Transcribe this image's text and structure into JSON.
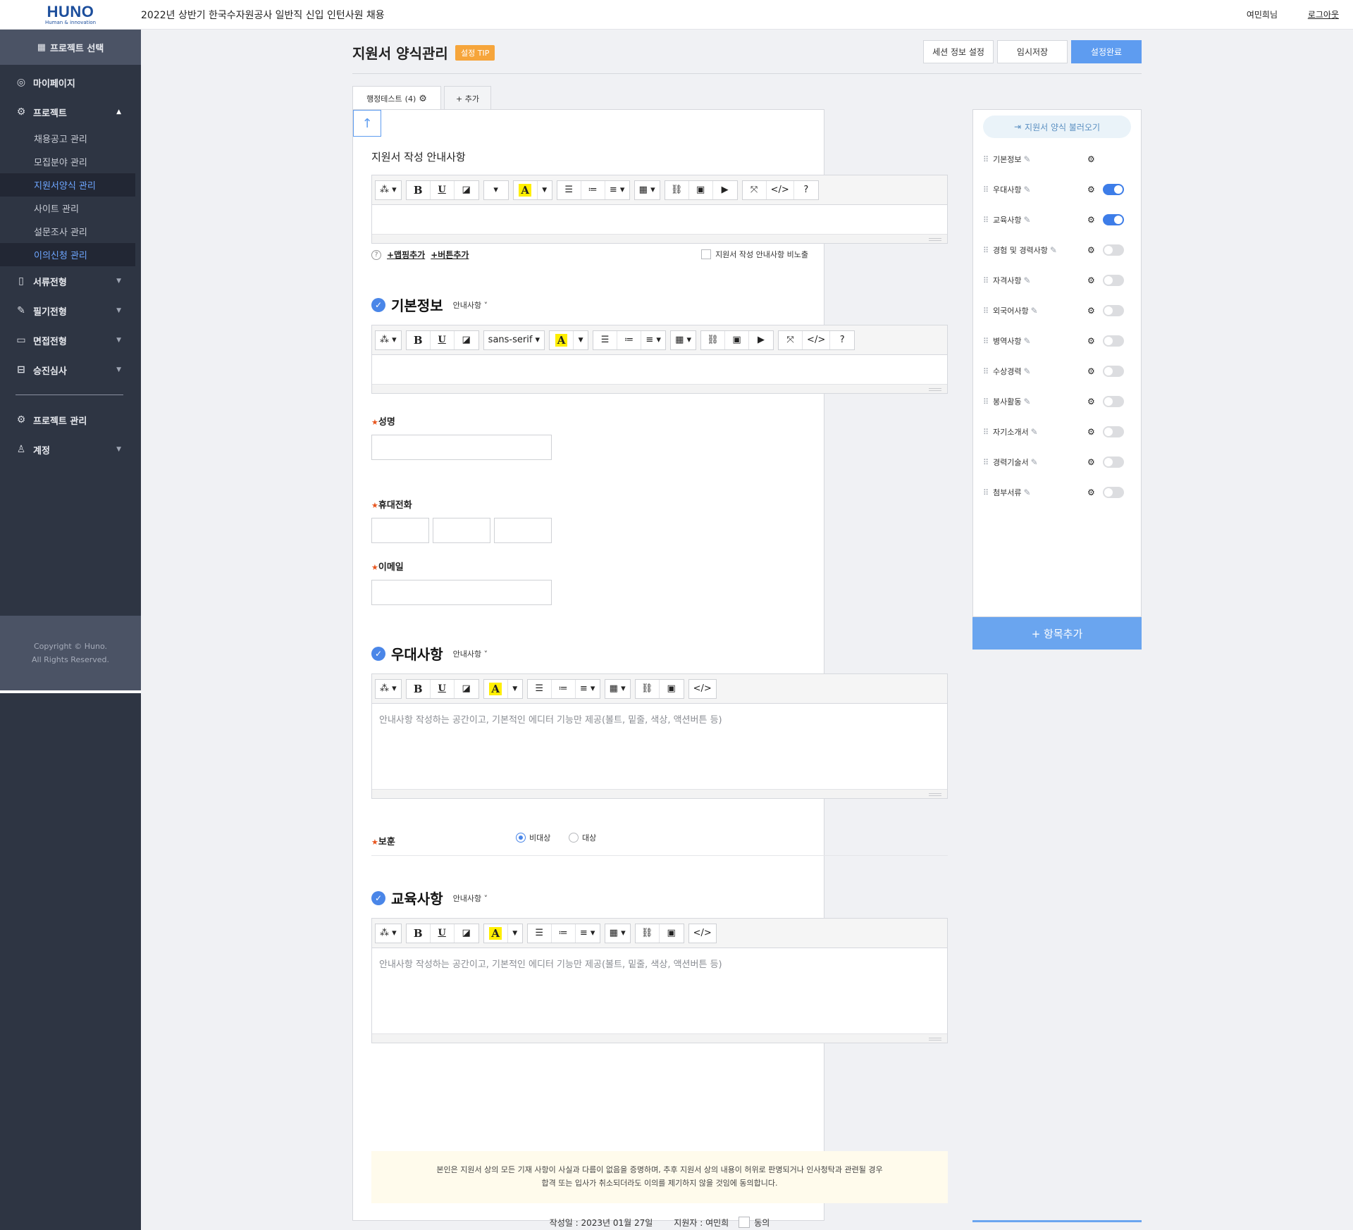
{
  "header": {
    "logo_main": "HUNO",
    "logo_sub": "Human & innovation",
    "project_title": "2022년 상반기 한국수자원공사 일반직 신입 인턴사원 채용",
    "user": "여민희님",
    "logout": "로그아웃"
  },
  "sidebar": {
    "project_select": "프로젝트 선택",
    "mypage": "마이페이지",
    "project": "프로젝트",
    "sub_items": [
      "채용공고 관리",
      "모집분야 관리",
      "지원서양식 관리",
      "사이트 관리",
      "설문조사 관리",
      "이의신청 관리"
    ],
    "stages": [
      "서류전형",
      "필기전형",
      "면접전형",
      "승진심사"
    ],
    "project_manage": "프로젝트 관리",
    "account": "계정",
    "copyright_1": "Copyright © Huno.",
    "copyright_2": "All Rights Reserved."
  },
  "page": {
    "title": "지원서 양식관리",
    "tip": "설정 TIP",
    "btn_section": "세션 정보 설정",
    "btn_temp": "임시저장",
    "btn_done": "설정완료",
    "tab_name": "행정테스트",
    "tab_count": "(4)",
    "tab_add": "+ 추가"
  },
  "guide": {
    "title": "지원서 작성 안내사항",
    "add_mapping": "+맵핑추가",
    "add_button": "+버튼추가",
    "hide_label": "지원서 작성 안내사항 비노출"
  },
  "sections": {
    "basic": {
      "title": "기본정보",
      "guide": "안내사항",
      "font": "sans-serif"
    },
    "pref": {
      "title": "우대사항",
      "guide": "안내사항",
      "placeholder": "안내사항 작성하는 공간이고, 기본적인 에디터 기능만 제공(볼트, 밑줄, 색상, 액션버튼 등)"
    },
    "edu": {
      "title": "교육사항",
      "guide": "안내사항",
      "placeholder": "안내사항 작성하는 공간이고, 기본적인 에디터 기능만 제공(볼트, 밑줄, 색상, 액션버튼 등)"
    }
  },
  "fields": {
    "name": "성명",
    "phone": "휴대전화",
    "email": "이메일",
    "veteran": "보훈",
    "veteran_opt1": "비대상",
    "veteran_opt2": "대상",
    "star": "★"
  },
  "footer": {
    "notice_1": "본인은 지원서 상의 모든 기재 사항이 사실과 다름이 없음을 증명하며, 추후 지원서 상의 내용이 허위로 판명되거나 인사청탁과 관련될 경우",
    "notice_2": "합격 또는 입사가 취소되더라도 이의를 제기하지 않을 것임에 동의합니다.",
    "date": "작성일 : 2023년 01월 27일",
    "applicant": "지원자 : 여민희",
    "agree": "동의"
  },
  "right_panel": {
    "load_button": "지원서 양식 불러오기",
    "items": [
      {
        "name": "기본정보",
        "toggle": null
      },
      {
        "name": "우대사항",
        "toggle": true
      },
      {
        "name": "교육사항",
        "toggle": true
      },
      {
        "name": "경험 및 경력사항",
        "toggle": false
      },
      {
        "name": "자격사항",
        "toggle": false
      },
      {
        "name": "외국어사항",
        "toggle": false
      },
      {
        "name": "병역사항",
        "toggle": false
      },
      {
        "name": "수상경력",
        "toggle": false
      },
      {
        "name": "봉사활동",
        "toggle": false
      },
      {
        "name": "자기소개서",
        "toggle": false
      },
      {
        "name": "경력기술서",
        "toggle": false
      },
      {
        "name": "첨부서류",
        "toggle": false
      }
    ],
    "add_item": "+ 항목추가"
  },
  "colors": {
    "accent": "#5e9cf0",
    "sidebar": "#2e3543",
    "tip": "#f6a53b",
    "active_nav": "#6ea6ff"
  }
}
